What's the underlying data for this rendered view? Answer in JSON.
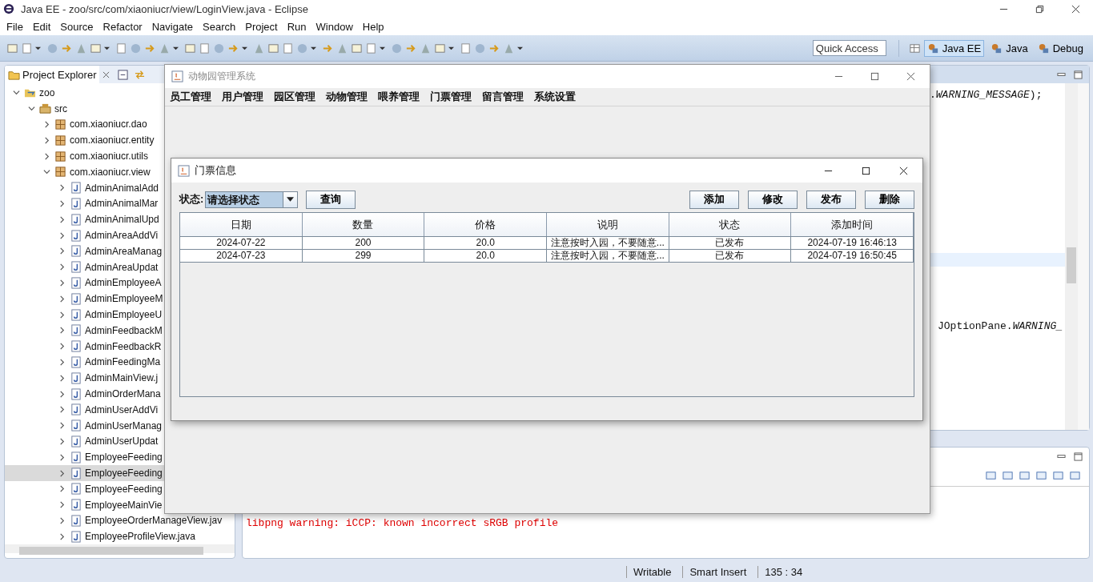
{
  "window": {
    "title": "Java EE - zoo/src/com/xiaoniucr/view/LoginView.java - Eclipse"
  },
  "menu": [
    "File",
    "Edit",
    "Source",
    "Refactor",
    "Navigate",
    "Search",
    "Project",
    "Run",
    "Window",
    "Help"
  ],
  "quick_access": {
    "placeholder": "Quick Access"
  },
  "perspectives": [
    {
      "label": "Java EE",
      "selected": true
    },
    {
      "label": "Java",
      "selected": false
    },
    {
      "label": "Debug",
      "selected": false
    }
  ],
  "explorer": {
    "title": "Project Explorer",
    "tree": [
      {
        "label": "zoo",
        "kind": "project",
        "expanded": true,
        "selected": false,
        "children": [
          {
            "label": "src",
            "kind": "source-folder",
            "expanded": true,
            "selected": false,
            "children": [
              {
                "label": "com.xiaoniucr.dao",
                "kind": "package",
                "expanded": false,
                "selected": false
              },
              {
                "label": "com.xiaoniucr.entity",
                "kind": "package",
                "expanded": false,
                "selected": false
              },
              {
                "label": "com.xiaoniucr.utils",
                "kind": "package",
                "expanded": false,
                "selected": false
              },
              {
                "label": "com.xiaoniucr.view",
                "kind": "package",
                "expanded": true,
                "selected": false,
                "children": [
                  {
                    "label": "AdminAnimalAdd",
                    "kind": "java-file",
                    "expanded": false,
                    "selected": false
                  },
                  {
                    "label": "AdminAnimalMar",
                    "kind": "java-file",
                    "expanded": false,
                    "selected": false
                  },
                  {
                    "label": "AdminAnimalUpd",
                    "kind": "java-file",
                    "expanded": false,
                    "selected": false
                  },
                  {
                    "label": "AdminAreaAddVi",
                    "kind": "java-file",
                    "expanded": false,
                    "selected": false
                  },
                  {
                    "label": "AdminAreaManag",
                    "kind": "java-file",
                    "expanded": false,
                    "selected": false
                  },
                  {
                    "label": "AdminAreaUpdat",
                    "kind": "java-file",
                    "expanded": false,
                    "selected": false
                  },
                  {
                    "label": "AdminEmployeeA",
                    "kind": "java-file",
                    "expanded": false,
                    "selected": false
                  },
                  {
                    "label": "AdminEmployeeM",
                    "kind": "java-file",
                    "expanded": false,
                    "selected": false
                  },
                  {
                    "label": "AdminEmployeeU",
                    "kind": "java-file",
                    "expanded": false,
                    "selected": false
                  },
                  {
                    "label": "AdminFeedbackM",
                    "kind": "java-file",
                    "expanded": false,
                    "selected": false
                  },
                  {
                    "label": "AdminFeedbackR",
                    "kind": "java-file",
                    "expanded": false,
                    "selected": false
                  },
                  {
                    "label": "AdminFeedingMa",
                    "kind": "java-file",
                    "expanded": false,
                    "selected": false
                  },
                  {
                    "label": "AdminMainView.j",
                    "kind": "java-file",
                    "expanded": false,
                    "selected": false
                  },
                  {
                    "label": "AdminOrderMana",
                    "kind": "java-file",
                    "expanded": false,
                    "selected": false
                  },
                  {
                    "label": "AdminUserAddVi",
                    "kind": "java-file",
                    "expanded": false,
                    "selected": false
                  },
                  {
                    "label": "AdminUserManag",
                    "kind": "java-file",
                    "expanded": false,
                    "selected": false
                  },
                  {
                    "label": "AdminUserUpdat",
                    "kind": "java-file",
                    "expanded": false,
                    "selected": false
                  },
                  {
                    "label": "EmployeeFeeding",
                    "kind": "java-file",
                    "expanded": false,
                    "selected": false
                  },
                  {
                    "label": "EmployeeFeeding",
                    "kind": "java-file",
                    "expanded": false,
                    "selected": true
                  },
                  {
                    "label": "EmployeeFeeding",
                    "kind": "java-file",
                    "expanded": false,
                    "selected": false
                  },
                  {
                    "label": "EmployeeMainVie",
                    "kind": "java-file",
                    "expanded": false,
                    "selected": false
                  },
                  {
                    "label": "EmployeeOrderManageView.jav",
                    "kind": "java-file",
                    "expanded": false,
                    "selected": false
                  },
                  {
                    "label": "EmployeeProfileView.java",
                    "kind": "java-file",
                    "expanded": false,
                    "selected": false
                  }
                ]
              }
            ]
          }
        ]
      }
    ]
  },
  "editor": {
    "lines": [
      ".*WARNING_MESSAGE*);",
      "JOptionPane.*WARNING_*"
    ]
  },
  "console": {
    "lines": [
      "libpng warning: iCCP: known incorrect sRGB profile"
    ]
  },
  "status_bar": [
    "Writable",
    "Smart Insert",
    "135 : 34"
  ],
  "app": {
    "title": "动物园管理系统",
    "menu": [
      "员工管理",
      "用户管理",
      "园区管理",
      "动物管理",
      "喂养管理",
      "门票管理",
      "留言管理",
      "系统设置"
    ]
  },
  "dialog": {
    "title": "门票信息",
    "filter_label": "状态:",
    "filter_value": "请选择状态",
    "query_button": "查询",
    "buttons": [
      "添加",
      "修改",
      "发布",
      "删除"
    ],
    "table": {
      "columns": [
        "日期",
        "数量",
        "价格",
        "说明",
        "状态",
        "添加时间"
      ],
      "rows": [
        [
          "2024-07-22",
          "200",
          "20.0",
          "注意按时入园，不要随意...",
          "已发布",
          "2024-07-19 16:46:13"
        ],
        [
          "2024-07-23",
          "299",
          "20.0",
          "注意按时入园，不要随意...",
          "已发布",
          "2024-07-19 16:50:45"
        ]
      ]
    }
  }
}
